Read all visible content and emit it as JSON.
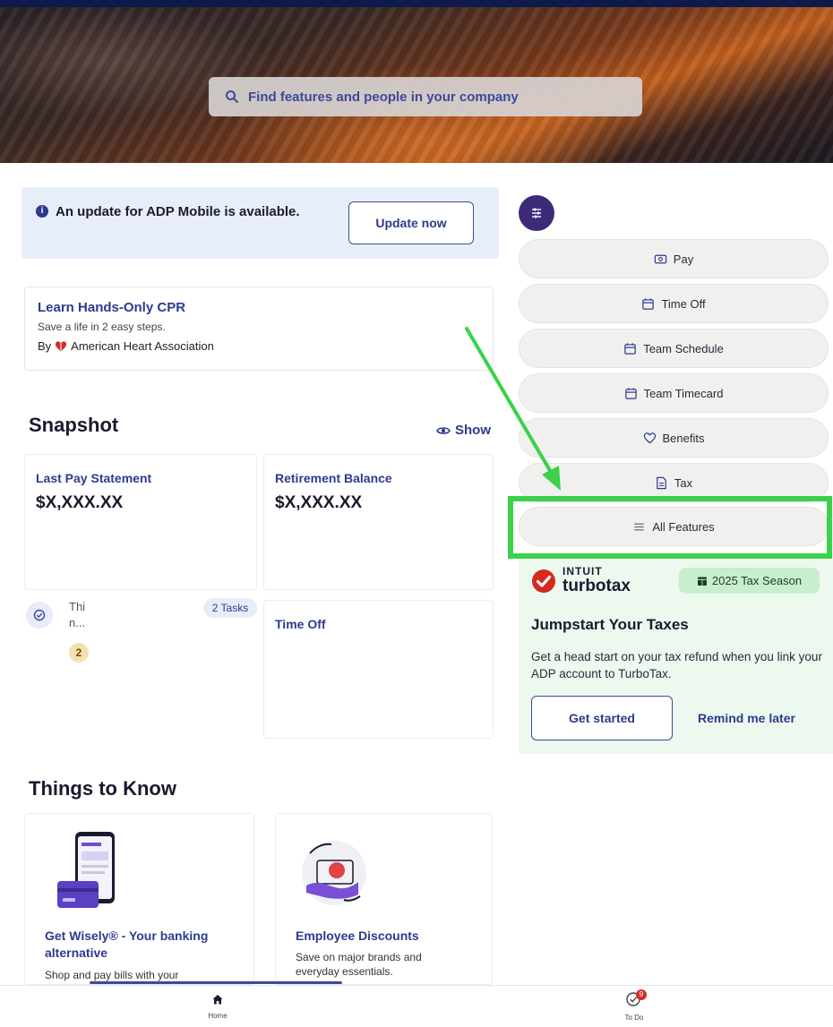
{
  "search": {
    "placeholder": "Find features and people in your company"
  },
  "update_banner": {
    "message": "An update for ADP Mobile is available.",
    "button": "Update now"
  },
  "cpr_card": {
    "title": "Learn Hands-Only CPR",
    "subtitle": "Save a life in 2 easy steps.",
    "by_prefix": "By",
    "org": "American Heart Association"
  },
  "snapshot": {
    "title": "Snapshot",
    "show_label": "Show",
    "cards": [
      {
        "label": "Last Pay Statement",
        "value": "$X,XXX.XX"
      },
      {
        "label": "Retirement Balance",
        "value": "$X,XXX.XX"
      },
      {
        "label": "Time Off"
      }
    ],
    "tasks": {
      "line1": "Thi",
      "line2": "n...",
      "badge": "2 Tasks",
      "count": "2"
    }
  },
  "features": {
    "items": [
      {
        "label": "Pay",
        "icon": "pay-icon"
      },
      {
        "label": "Time Off",
        "icon": "calendar-icon"
      },
      {
        "label": "Team Schedule",
        "icon": "calendar-icon"
      },
      {
        "label": "Team Timecard",
        "icon": "calendar-icon"
      },
      {
        "label": "Benefits",
        "icon": "heart-icon"
      },
      {
        "label": "Tax",
        "icon": "tax-doc-icon"
      },
      {
        "label": "All Features",
        "icon": "menu-icon"
      }
    ]
  },
  "turbotax": {
    "brand_top": "INTUIT",
    "brand_bottom": "turbotax",
    "season": "2025 Tax Season",
    "title": "Jumpstart Your Taxes",
    "description": "Get a head start on your tax refund when you link your ADP account to TurboTax.",
    "start_button": "Get started",
    "later_link": "Remind me later"
  },
  "things_to_know": {
    "title": "Things to Know",
    "cards": [
      {
        "heading": "Get Wisely® - Your banking alternative",
        "body": "Shop and pay bills with your"
      },
      {
        "heading": "Employee Discounts",
        "body": "Save on major brands and everyday essentials."
      }
    ]
  },
  "bottom_nav": {
    "home": "Home",
    "todo": "To Do",
    "todo_badge": "9"
  },
  "colors": {
    "accent": "#2c3b8f",
    "highlight": "#3bd14a",
    "turbotax_bg": "#edf9ef",
    "feature_toggle": "#3d2a78"
  }
}
